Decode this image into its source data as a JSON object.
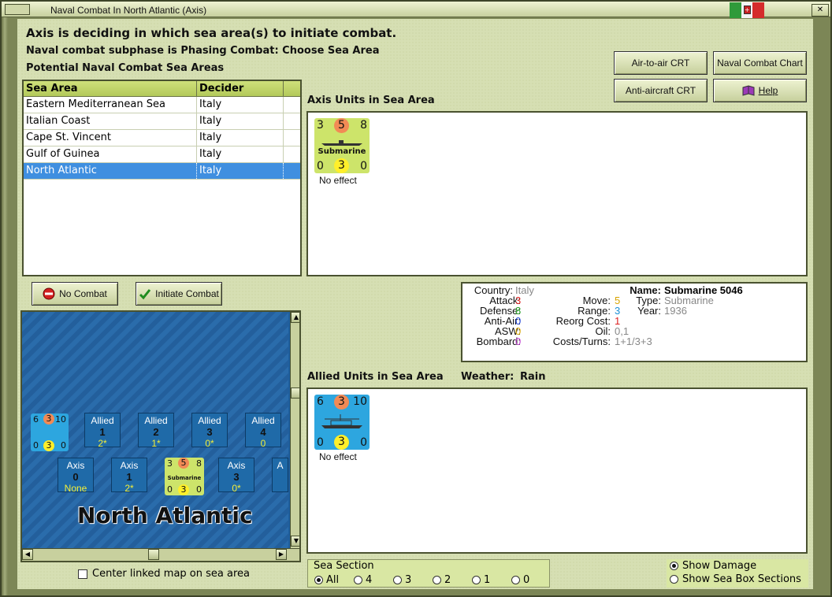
{
  "window": {
    "title": "Naval Combat In North Atlantic (Axis)"
  },
  "header": {
    "line1": "Axis is deciding in which sea area(s) to initiate combat.",
    "line2": "Naval combat subphase is Phasing Combat: Choose Sea Area",
    "line3": "Potential Naval Combat Sea Areas"
  },
  "buttons": {
    "air_to_air": "Air-to-air CRT",
    "naval_chart": "Naval Combat Chart",
    "anti_aircraft": "Anti-aircraft CRT",
    "help": "Help",
    "no_combat": "No Combat",
    "initiate": "Initiate Combat"
  },
  "table": {
    "headers": [
      "Sea Area",
      "Decider"
    ],
    "rows": [
      [
        "Eastern Mediterranean Sea",
        "Italy"
      ],
      [
        "Italian Coast",
        "Italy"
      ],
      [
        "Cape St. Vincent",
        "Italy"
      ],
      [
        "Gulf of Guinea",
        "Italy"
      ],
      [
        "North Atlantic",
        "Italy"
      ]
    ]
  },
  "axis_panel": {
    "label": "Axis Units in Sea Area",
    "unit": {
      "tl": "3",
      "tm": "5",
      "tr": "8",
      "name": "Submarine",
      "bl": "0",
      "bm": "3",
      "br": "0",
      "result": "No effect"
    }
  },
  "allied_panel": {
    "label": "Allied Units in Sea Area",
    "weather_label": "Weather:",
    "weather": "Rain",
    "unit": {
      "tl": "6",
      "tm": "3",
      "tr": "10",
      "bl": "0",
      "bm": "3",
      "br": "0",
      "result": "No effect"
    }
  },
  "info": {
    "country_label": "Country:",
    "country": "Italy",
    "attack_label": "Attack:",
    "attack": "3",
    "defense_label": "Defense:",
    "defense": "8",
    "antiair_label": "Anti-Air:",
    "antiair": "0",
    "asw_label": "ASW:",
    "asw": "0",
    "bombard_label": "Bombard:",
    "bombard": "0",
    "move_label": "Move:",
    "move": "5",
    "range_label": "Range:",
    "range": "3",
    "reorg_label": "Reorg Cost:",
    "reorg": "1",
    "oil_label": "Oil:",
    "oil": "0,1",
    "costs_label": "Costs/Turns:",
    "costs": "1+1/3+3",
    "name_label": "Name:",
    "name": "Submarine 5046",
    "type_label": "Type:",
    "type": "Submarine",
    "year_label": "Year:",
    "year": "1936"
  },
  "map": {
    "title": "North Atlantic",
    "allied_boxes": [
      {
        "side": "Allied",
        "num": "1",
        "val": "2*"
      },
      {
        "side": "Allied",
        "num": "2",
        "val": "1*"
      },
      {
        "side": "Allied",
        "num": "3",
        "val": "0*"
      },
      {
        "side": "Allied",
        "num": "4",
        "val": "0"
      }
    ],
    "axis_boxes": [
      {
        "side": "Axis",
        "num": "0",
        "val": "None"
      },
      {
        "side": "Axis",
        "num": "1",
        "val": "2*"
      },
      {
        "side": "Axis",
        "num": "3",
        "val": "0*"
      },
      {
        "side": "A",
        "num": "",
        "val": ""
      }
    ],
    "allied_counter": {
      "tl": "6",
      "tm": "3",
      "tr": "10",
      "bl": "0",
      "bm": "3",
      "br": "0"
    },
    "axis_counter": {
      "tl": "3",
      "tm": "5",
      "tr": "8",
      "name": "Submarine",
      "bl": "0",
      "bm": "3",
      "br": "0"
    }
  },
  "center_linked": "Center linked map on sea area",
  "sea_section": {
    "label": "Sea Section",
    "options": [
      "All",
      "4",
      "3",
      "2",
      "1",
      "0"
    ]
  },
  "options": {
    "show_damage": "Show Damage",
    "show_boxes": "Show Sea Box Sections"
  },
  "colors": {
    "background": "#d6dfb3",
    "selection": "#3f8fe0",
    "axis_counter": "#cde46a",
    "allied_counter": "#2da6df",
    "attack": "#d22",
    "defense": "#1a9a1a",
    "antiair": "#1a3fd6",
    "asw": "#d8a400",
    "bombard": "#c03fd0",
    "move": "#d8a400",
    "range": "#1a8fd6",
    "reorg": "#d22",
    "muted": "#888"
  }
}
